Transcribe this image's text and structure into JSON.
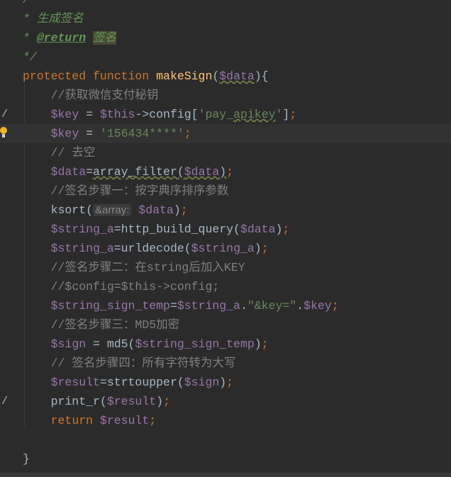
{
  "editor": {
    "colors": {
      "background": "#2b2b2b",
      "current_line": "#323232",
      "keyword": "#cc7832",
      "function": "#ffc66d",
      "variable": "#9876aa",
      "string": "#6a8759",
      "comment": "#808080",
      "doc": "#629755"
    },
    "lines": [
      {
        "tokens": [
          [
            "doc",
            "/"
          ]
        ]
      },
      {
        "tokens": [
          [
            "doc",
            "* 生成签名"
          ]
        ]
      },
      {
        "tokens": [
          [
            "doc",
            "* "
          ],
          [
            "doctag",
            "@return"
          ],
          [
            "doc",
            " "
          ],
          [
            "dochl",
            "签名"
          ]
        ]
      },
      {
        "tokens": [
          [
            "doc",
            "*/"
          ]
        ]
      },
      {
        "tokens": [
          [
            "kw",
            "protected function "
          ],
          [
            "fn",
            "makeSign"
          ],
          [
            "plain",
            "("
          ],
          [
            "varw",
            "$data"
          ],
          [
            "plain",
            "){"
          ]
        ]
      },
      {
        "tokens": [
          [
            "plain",
            "    "
          ],
          [
            "comment",
            "//获取微信支付秘钥"
          ]
        ]
      },
      {
        "gutter": "/",
        "tokens": [
          [
            "plain",
            "    "
          ],
          [
            "var",
            "$key"
          ],
          [
            "plain",
            " = "
          ],
          [
            "var",
            "$this"
          ],
          [
            "plain",
            "->config["
          ],
          [
            "str",
            "'pay_"
          ],
          [
            "strw",
            "apikey"
          ],
          [
            "str",
            "'"
          ],
          [
            "plain",
            "]"
          ],
          [
            "kw",
            ";"
          ]
        ]
      },
      {
        "current": true,
        "bulb": true,
        "tokens": [
          [
            "plain",
            "    "
          ],
          [
            "var",
            "$key"
          ],
          [
            "plain",
            " = "
          ],
          [
            "str",
            "'156434****'"
          ],
          [
            "kw",
            ";"
          ]
        ]
      },
      {
        "tokens": [
          [
            "plain",
            "    "
          ],
          [
            "comment",
            "// 去空"
          ]
        ]
      },
      {
        "tokens": [
          [
            "plain",
            "    "
          ],
          [
            "var",
            "$data"
          ],
          [
            "plain",
            "="
          ],
          [
            "plainw",
            "array_filter("
          ],
          [
            "varw",
            "$data"
          ],
          [
            "plainw",
            ")"
          ],
          [
            "kw",
            ";"
          ]
        ]
      },
      {
        "tokens": [
          [
            "plain",
            "    "
          ],
          [
            "comment",
            "//签名步骤一：按字典序排序参数"
          ]
        ]
      },
      {
        "tokens": [
          [
            "plain",
            "    ksort("
          ],
          [
            "hint",
            "&array:"
          ],
          [
            "plain",
            " "
          ],
          [
            "var",
            "$data"
          ],
          [
            "plain",
            ")"
          ],
          [
            "kw",
            ";"
          ]
        ]
      },
      {
        "tokens": [
          [
            "plain",
            "    "
          ],
          [
            "var",
            "$string_a"
          ],
          [
            "plain",
            "=http_build_query("
          ],
          [
            "var",
            "$data"
          ],
          [
            "plain",
            ")"
          ],
          [
            "kw",
            ";"
          ]
        ]
      },
      {
        "tokens": [
          [
            "plain",
            "    "
          ],
          [
            "var",
            "$string_a"
          ],
          [
            "plain",
            "=urldecode("
          ],
          [
            "var",
            "$string_a"
          ],
          [
            "plain",
            ")"
          ],
          [
            "kw",
            ";"
          ]
        ]
      },
      {
        "tokens": [
          [
            "plain",
            "    "
          ],
          [
            "comment",
            "//签名步骤二：在string后加入KEY"
          ]
        ]
      },
      {
        "tokens": [
          [
            "plain",
            "    "
          ],
          [
            "comment",
            "//$config=$this->config;"
          ]
        ]
      },
      {
        "tokens": [
          [
            "plain",
            "    "
          ],
          [
            "var",
            "$string_sign_temp"
          ],
          [
            "plain",
            "="
          ],
          [
            "var",
            "$string_a"
          ],
          [
            "plain",
            "."
          ],
          [
            "str",
            "\"&key=\""
          ],
          [
            "plain",
            "."
          ],
          [
            "var",
            "$key"
          ],
          [
            "kw",
            ";"
          ]
        ]
      },
      {
        "tokens": [
          [
            "plain",
            "    "
          ],
          [
            "comment",
            "//签名步骤三：MD5加密"
          ]
        ]
      },
      {
        "tokens": [
          [
            "plain",
            "    "
          ],
          [
            "var",
            "$sign"
          ],
          [
            "plain",
            " = md5("
          ],
          [
            "var",
            "$string_sign_temp"
          ],
          [
            "plain",
            ")"
          ],
          [
            "kw",
            ";"
          ]
        ]
      },
      {
        "tokens": [
          [
            "plain",
            "    "
          ],
          [
            "comment",
            "// 签名步骤四：所有字符转为大写"
          ]
        ]
      },
      {
        "tokens": [
          [
            "plain",
            "    "
          ],
          [
            "var",
            "$result"
          ],
          [
            "plain",
            "=strtoupper("
          ],
          [
            "var",
            "$sign"
          ],
          [
            "plain",
            ")"
          ],
          [
            "kw",
            ";"
          ]
        ]
      },
      {
        "gutter": "/",
        "tokens": [
          [
            "plain",
            "    print_r("
          ],
          [
            "var",
            "$result"
          ],
          [
            "plain",
            ")"
          ],
          [
            "kw",
            ";"
          ]
        ]
      },
      {
        "tokens": [
          [
            "plain",
            "    "
          ],
          [
            "kw",
            "return "
          ],
          [
            "var",
            "$result"
          ],
          [
            "kw",
            ";"
          ]
        ]
      },
      {
        "tokens": []
      },
      {
        "tokens": [
          [
            "plain",
            "}"
          ]
        ]
      }
    ]
  }
}
